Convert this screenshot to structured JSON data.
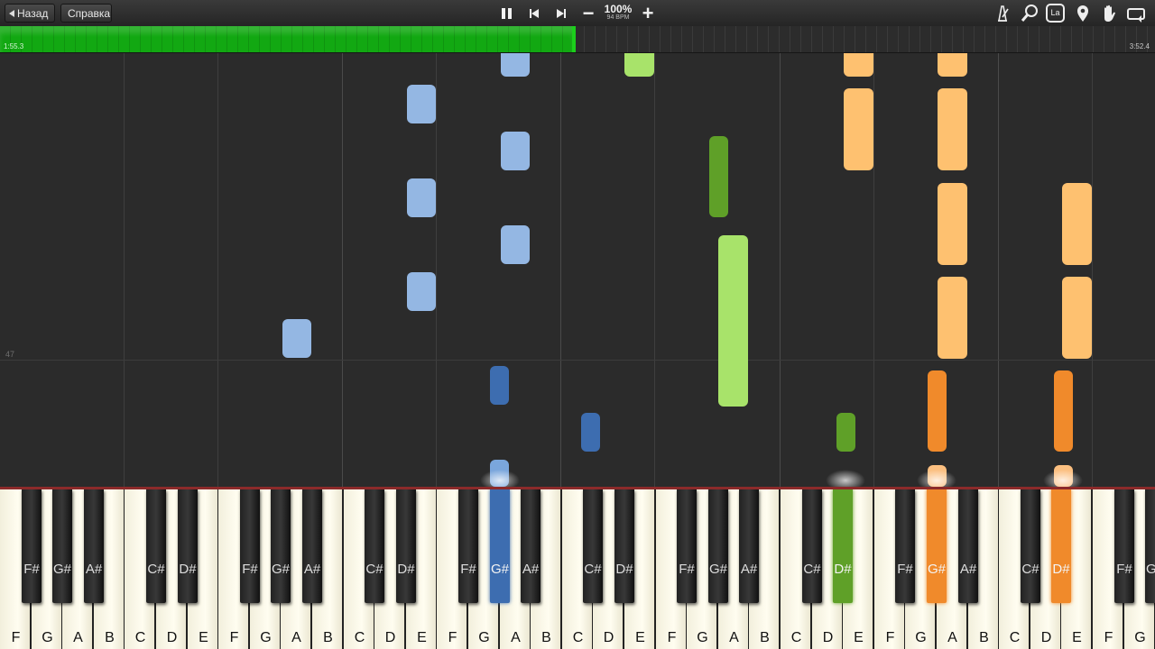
{
  "toolbar": {
    "back_label": "Назад",
    "help_label": "Справка",
    "speed_percent": "100%",
    "speed_bpm": "94 BPM",
    "slower_label": "−",
    "faster_label": "+",
    "right_icons": [
      "metronome-icon",
      "magnifier-icon",
      "la-label-icon",
      "marker-pin-icon",
      "hand-icon",
      "loop-icon"
    ],
    "la_text": "La"
  },
  "progress": {
    "current_time": "1:55.3",
    "total_time": "3:52.4",
    "fraction": 0.497
  },
  "roll": {
    "measure_number": "47"
  },
  "colors": {
    "right_hand_light": "#94b7e3",
    "right_hand_dark": "#3d6db0",
    "left_hand_light": "#a8e36a",
    "left_hand_dark": "#5fa028",
    "orange_light": "#fec170",
    "orange_dark": "#f08a2b",
    "progress_green": "#12a812"
  },
  "keyboard": {
    "white_keys": [
      "F",
      "G",
      "A",
      "B",
      "C",
      "D",
      "E",
      "F",
      "G",
      "A",
      "B",
      "C",
      "D",
      "E",
      "F",
      "G",
      "A",
      "B",
      "C",
      "D",
      "E",
      "F",
      "G",
      "A",
      "B",
      "C",
      "D",
      "E",
      "F",
      "G",
      "A",
      "B",
      "C",
      "D",
      "E",
      "F",
      "G",
      "A"
    ],
    "black_keys": [
      "F#",
      "G#",
      "A#",
      "C#",
      "D#",
      "F#",
      "G#",
      "A#",
      "C#",
      "D#",
      "F#",
      "G#",
      "A#",
      "C#",
      "D#",
      "F#",
      "G#",
      "A#",
      "C#",
      "D#",
      "F#",
      "G#",
      "A#",
      "C#",
      "D#",
      "F#",
      "G#"
    ],
    "pressed": [
      {
        "key_index": 11,
        "color": "#3d6db0"
      },
      {
        "key_index": 19,
        "color": "#5fa028"
      },
      {
        "key_index": 21,
        "color": "#f08a2b"
      },
      {
        "key_index": 24,
        "color": "#f08a2b"
      }
    ]
  }
}
